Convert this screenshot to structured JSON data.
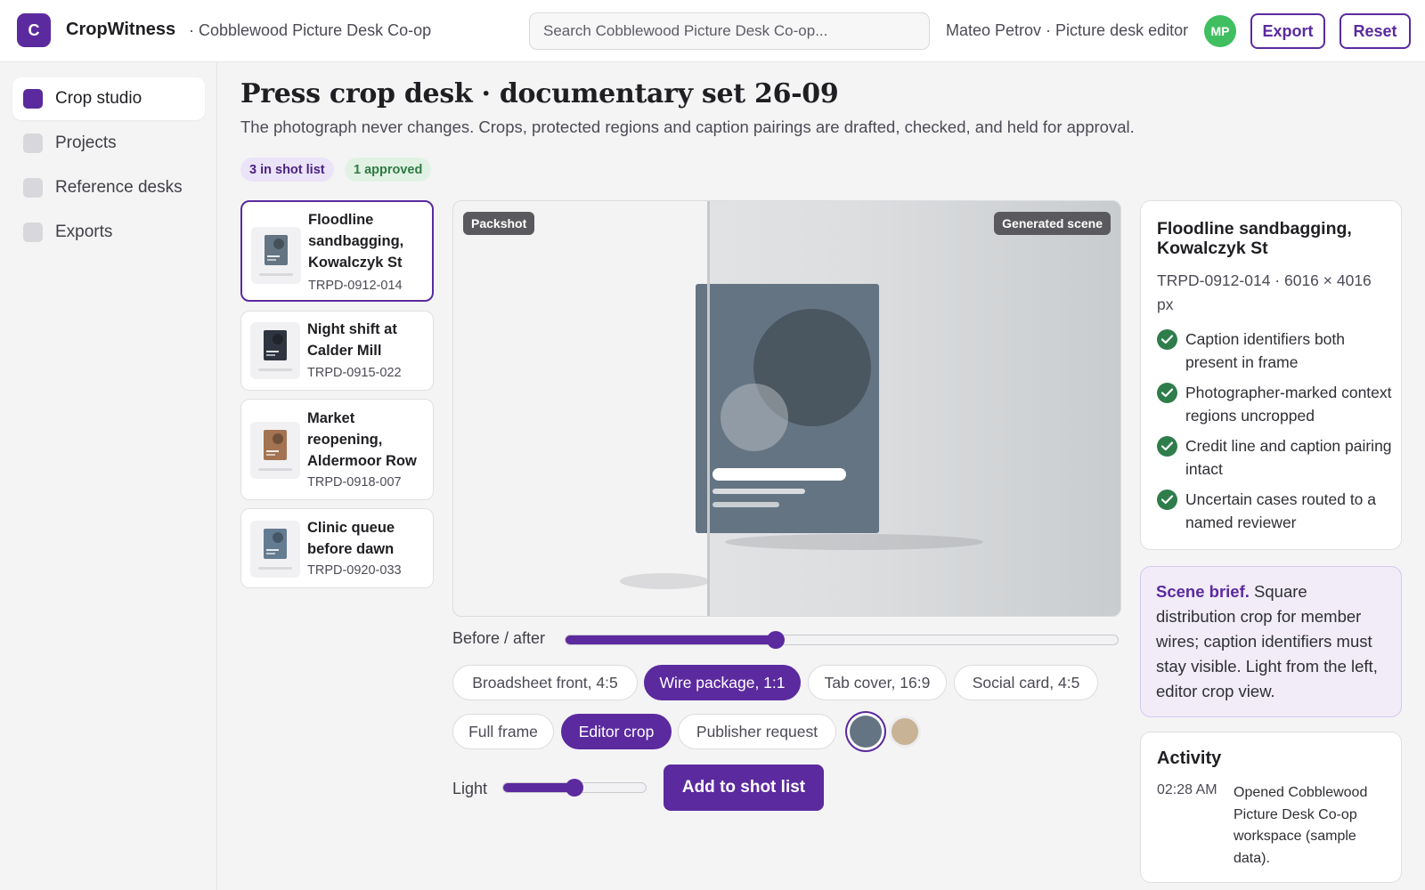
{
  "app": {
    "logo_letter": "C",
    "name": "CropWitness",
    "workspace": "· Cobblewood Picture Desk Co-op",
    "brand_color": "#5b2a9e"
  },
  "search": {
    "placeholder": "Search Cobblewood Picture Desk Co-op..."
  },
  "user": {
    "label": "Mateo Petrov · Picture desk editor",
    "initials": "MP"
  },
  "toolbar": {
    "export_label": "Export",
    "reset_label": "Reset"
  },
  "sidebar": {
    "items": [
      {
        "label": "Crop studio",
        "active": true
      },
      {
        "label": "Projects",
        "active": false
      },
      {
        "label": "Reference desks",
        "active": false
      },
      {
        "label": "Exports",
        "active": false
      }
    ]
  },
  "page": {
    "title": "Press crop desk · documentary set 26-09",
    "subtitle": "The photograph never changes. Crops, protected regions and caption pairings are drafted, checked, and held for approval.",
    "badges": {
      "shot_list": "3 in shot list",
      "approved": "1 approved"
    }
  },
  "shots": [
    {
      "title": "Floodline sandbagging, Kowalczyk St",
      "code": "TRPD-0912-014",
      "selected": true,
      "color": "#647482"
    },
    {
      "title": "Night shift at Calder Mill",
      "code": "TRPD-0915-022",
      "selected": false,
      "color": "#2e3440"
    },
    {
      "title": "Market reopening, Aldermoor Row",
      "code": "TRPD-0918-007",
      "selected": false,
      "color": "#a37352"
    },
    {
      "title": "Clinic queue before dawn",
      "code": "TRPD-0920-033",
      "selected": false,
      "color": "#647c92"
    }
  ],
  "preview": {
    "left_tag": "Packshot",
    "right_tag": "Generated scene",
    "subject_color": "#647482"
  },
  "controls": {
    "before_after_label": "Before / after",
    "before_after_value": 0.38,
    "formats": [
      {
        "label": "Broadsheet front, 4:5",
        "on": false
      },
      {
        "label": "Wire package, 1:1",
        "on": true
      },
      {
        "label": "Tab cover, 16:9",
        "on": false
      },
      {
        "label": "Social card, 4:5",
        "on": false
      }
    ],
    "views": [
      {
        "label": "Full frame",
        "on": false
      },
      {
        "label": "Editor crop",
        "on": true
      },
      {
        "label": "Publisher request",
        "on": false
      }
    ],
    "swatches": [
      "#647482",
      "#c8b396"
    ],
    "light_label": "Light",
    "light_value": 0.5,
    "add_label": "Add to shot list"
  },
  "details": {
    "title": "Floodline sandbagging, Kowalczyk St",
    "meta": "TRPD-0912-014 · 6016 × 4016 px",
    "checks": [
      "Caption identifiers both present in frame",
      "Photographer-marked context regions uncropped",
      "Credit line and caption pairing intact",
      "Uncertain cases routed to a named reviewer"
    ]
  },
  "brief": {
    "label": "Scene brief.",
    "text": " Square distribution crop for member wires; caption identifiers must stay visible. Light from the left, editor crop view."
  },
  "activity": {
    "title": "Activity",
    "items": [
      {
        "time": "02:28 AM",
        "text": "Opened Cobblewood Picture Desk Co-op workspace (sample data)."
      }
    ]
  }
}
